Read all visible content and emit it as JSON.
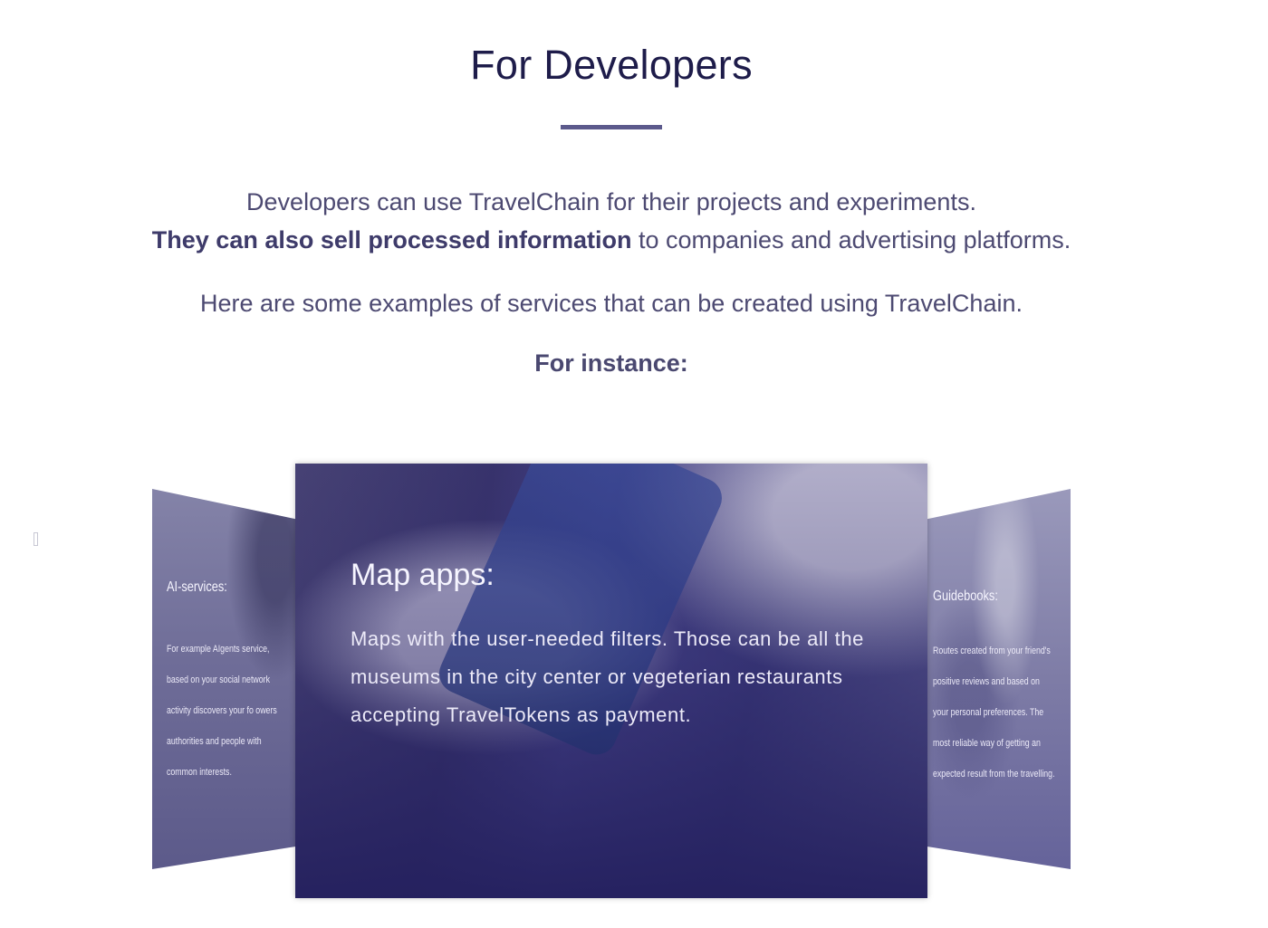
{
  "section": {
    "title": "For Developers",
    "intro_line1": "Developers can use TravelChain for their projects and experiments.",
    "intro_bold": "They can also sell processed information",
    "intro_line2_rest": " to companies and advertising platforms.",
    "examples_text": "Here are some examples of services that can be created using TravelChain.",
    "for_instance": "For instance:"
  },
  "carousel": {
    "cards": [
      {
        "title": "AI-services:",
        "description": "For example AIgents service, based on your social network activity discovers your fo owers authorities and people with common interests."
      },
      {
        "title": "Map apps:",
        "description": "Maps with the user-needed filters. Those can be all the museums in the city center or vegeterian restaurants accepting TravelTokens as payment."
      },
      {
        "title": "Guidebooks:",
        "description": "Routes created from your friend's positive reviews and based on your personal preferences. The most reliable way of getting an expected result from the travelling."
      }
    ]
  },
  "colors": {
    "title": "#1e1c4a",
    "text": "#4d4a72",
    "accent_rule": "#5c5a8c",
    "card_overlay": "#2c2874"
  }
}
